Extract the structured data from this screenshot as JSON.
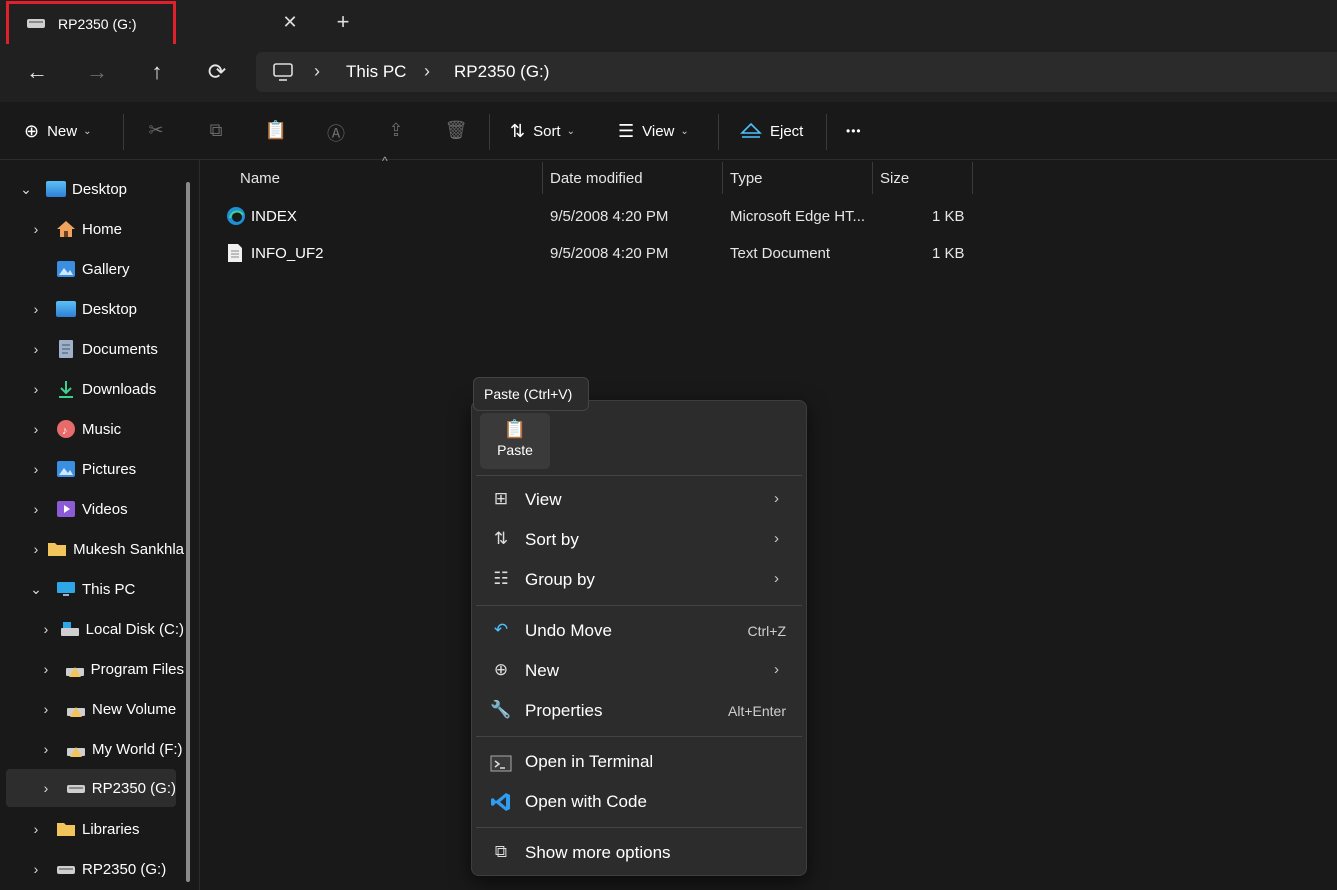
{
  "tab": {
    "title": "RP2350 (G:)",
    "close": "✕",
    "new_tab": "+"
  },
  "nav": {
    "back": "←",
    "forward": "→",
    "up": "↑",
    "refresh": "⟳"
  },
  "breadcrumb": {
    "sep": "›",
    "items": [
      "This PC",
      "RP2350 (G:)"
    ]
  },
  "toolbar": {
    "new_label": "New",
    "sort_label": "Sort",
    "view_label": "View",
    "eject_label": "Eject",
    "more": "•••"
  },
  "sidebar": {
    "items": [
      {
        "label": "Desktop",
        "chev": "⌄"
      },
      {
        "label": "Home",
        "chev": "›"
      },
      {
        "label": "Gallery",
        "chev": ""
      },
      {
        "label": "Desktop",
        "chev": "›"
      },
      {
        "label": "Documents",
        "chev": "›"
      },
      {
        "label": "Downloads",
        "chev": "›"
      },
      {
        "label": "Music",
        "chev": "›"
      },
      {
        "label": "Pictures",
        "chev": "›"
      },
      {
        "label": "Videos",
        "chev": "›"
      },
      {
        "label": "Mukesh Sankhla",
        "chev": "›"
      },
      {
        "label": "This PC",
        "chev": "⌄"
      },
      {
        "label": "Local Disk (C:)",
        "chev": "›"
      },
      {
        "label": "Program Files",
        "chev": "›"
      },
      {
        "label": "New Volume",
        "chev": "›"
      },
      {
        "label": "My World (F:)",
        "chev": "›"
      },
      {
        "label": "RP2350 (G:)",
        "chev": "›"
      },
      {
        "label": "Libraries",
        "chev": "›"
      },
      {
        "label": "RP2350 (G:)",
        "chev": "›"
      }
    ]
  },
  "filelist": {
    "columns": {
      "name": "Name",
      "date": "Date modified",
      "type": "Type",
      "size": "Size"
    },
    "sort_indicator": "^",
    "rows": [
      {
        "name": "INDEX",
        "date": "9/5/2008 4:20 PM",
        "type": "Microsoft Edge HT...",
        "size": "1 KB"
      },
      {
        "name": "INFO_UF2",
        "date": "9/5/2008 4:20 PM",
        "type": "Text Document",
        "size": "1 KB"
      }
    ]
  },
  "tooltip": {
    "text": "Paste (Ctrl+V)"
  },
  "context_menu": {
    "paste_label": "Paste",
    "items": [
      {
        "label": "View",
        "arrow": "›",
        "shortcut": ""
      },
      {
        "label": "Sort by",
        "arrow": "›",
        "shortcut": ""
      },
      {
        "label": "Group by",
        "arrow": "›",
        "shortcut": ""
      },
      {
        "label": "Undo Move",
        "arrow": "",
        "shortcut": "Ctrl+Z"
      },
      {
        "label": "New",
        "arrow": "›",
        "shortcut": ""
      },
      {
        "label": "Properties",
        "arrow": "",
        "shortcut": "Alt+Enter"
      },
      {
        "label": "Open in Terminal",
        "arrow": "",
        "shortcut": ""
      },
      {
        "label": "Open with Code",
        "arrow": "",
        "shortcut": ""
      },
      {
        "label": "Show more options",
        "arrow": "",
        "shortcut": ""
      }
    ]
  },
  "colors": {
    "highlight_box": "#e0202a",
    "accent": "#4cc2ff",
    "folder": "#f2c55c"
  }
}
